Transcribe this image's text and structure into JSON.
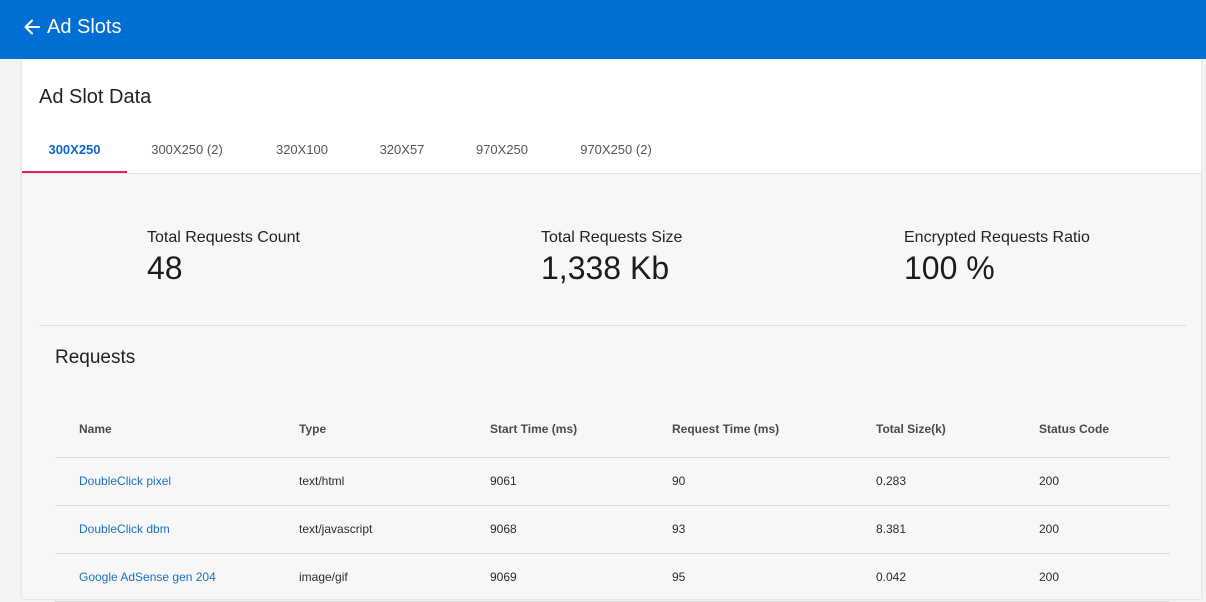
{
  "appbar": {
    "title": "Ad Slots",
    "back_icon": "arrow-left-icon",
    "color": "#006fd3"
  },
  "card": {
    "title": "Ad Slot Data"
  },
  "tabs": [
    {
      "label": "300X250",
      "active": true
    },
    {
      "label": "300X250 (2)",
      "active": false
    },
    {
      "label": "320X100",
      "active": false
    },
    {
      "label": "320X57",
      "active": false
    },
    {
      "label": "970X250",
      "active": false
    },
    {
      "label": "970X250 (2)",
      "active": false
    }
  ],
  "accent": {
    "tab_active_text": "#0b67c9",
    "tab_indicator": "#e91e63",
    "link": "#1a6fc2"
  },
  "stats": {
    "count": {
      "label": "Total Requests Count",
      "value": "48"
    },
    "size": {
      "label": "Total Requests Size",
      "value": "1,338 Kb"
    },
    "ratio": {
      "label": "Encrypted Requests Ratio",
      "value": "100 %"
    }
  },
  "requests": {
    "title": "Requests",
    "columns": [
      "Name",
      "Type",
      "Start Time (ms)",
      "Request Time (ms)",
      "Total Size(k)",
      "Status Code"
    ],
    "rows": [
      [
        "DoubleClick pixel",
        "text/html",
        "9061",
        "90",
        "0.283",
        "200"
      ],
      [
        "DoubleClick dbm",
        "text/javascript",
        "9068",
        "93",
        "8.381",
        "200"
      ],
      [
        "Google AdSense gen 204",
        "image/gif",
        "9069",
        "95",
        "0.042",
        "200"
      ]
    ]
  }
}
